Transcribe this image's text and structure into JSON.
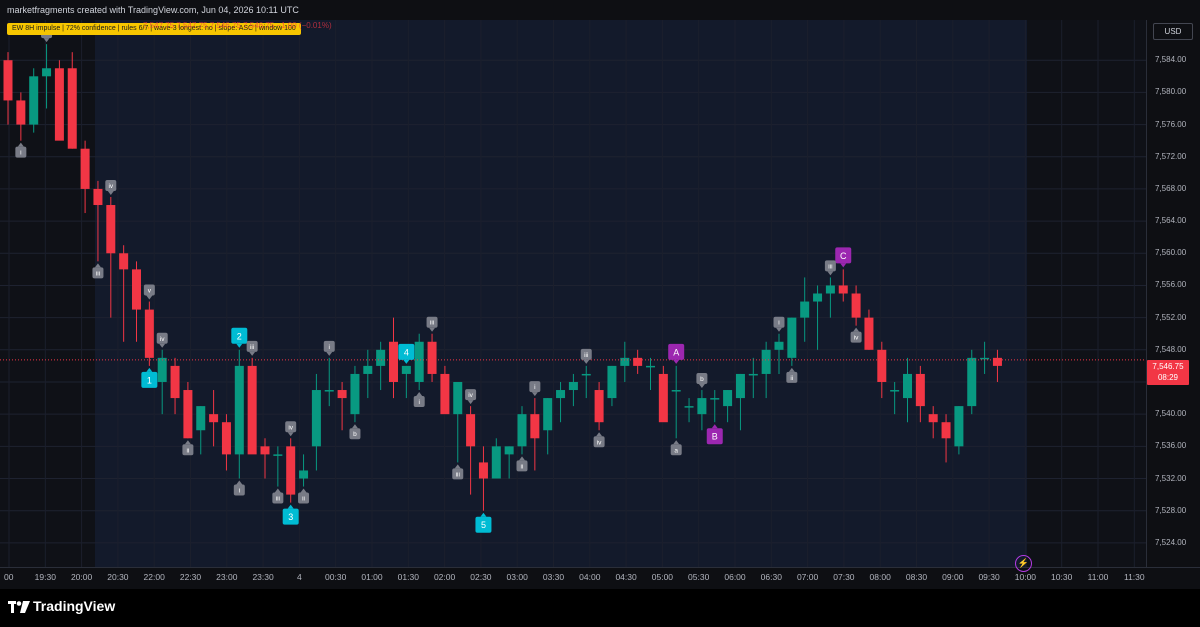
{
  "header": {
    "title": "marketfragments created with TradingView.com, Jun 04, 2026 10:11 UTC"
  },
  "indicator": {
    "label": "EW 8H impulse  |  72% confidence  |  rules 6/7  |  wave-3 longest: no  |  slope: ASC  |  window 100",
    "ohlc": "7,547.75  7,547.75  7,546.75  7,546.75  −1.00 (−0.01%)"
  },
  "axis": {
    "currency": "USD",
    "y_ticks": [
      "7,584.00",
      "7,580.00",
      "7,576.00",
      "7,572.00",
      "7,568.00",
      "7,564.00",
      "7,560.00",
      "7,556.00",
      "7,552.00",
      "7,548.00",
      "7,544.00",
      "7,540.00",
      "7,536.00",
      "7,532.00",
      "7,528.00",
      "7,524.00"
    ],
    "x_ticks": [
      "00",
      "19:30",
      "20:00",
      "20:30",
      "22:00",
      "22:30",
      "23:00",
      "23:30",
      "4",
      "00:30",
      "01:00",
      "01:30",
      "02:00",
      "02:30",
      "03:00",
      "03:30",
      "04:00",
      "04:30",
      "05:00",
      "05:30",
      "06:00",
      "06:30",
      "07:00",
      "07:30",
      "08:00",
      "08:30",
      "09:00",
      "09:30",
      "10:00",
      "10:30",
      "11:00",
      "11:30"
    ],
    "last_price": "7,546.75",
    "countdown": "08:29"
  },
  "chart_data": {
    "type": "candlestick",
    "y_range": [
      7521,
      7589
    ],
    "colors": {
      "up": "#089981",
      "down": "#f23645",
      "impulse": "#00bcd4",
      "corrective": "#9c27b0",
      "minor": "#787b86",
      "highlight": "#ffffff"
    },
    "candles": [
      [
        7584,
        7585,
        7576,
        7579
      ],
      [
        7579,
        7580,
        7574,
        7576
      ],
      [
        7576,
        7583,
        7575,
        7582
      ],
      [
        7582,
        7586,
        7578,
        7583
      ],
      [
        7583,
        7584,
        7575,
        7574
      ],
      [
        7583,
        7585,
        7573,
        7573
      ],
      [
        7573,
        7574,
        7565,
        7568
      ],
      [
        7568,
        7569,
        7559,
        7566
      ],
      [
        7566,
        7567,
        7552,
        7560
      ],
      [
        7560,
        7561,
        7549,
        7558
      ],
      [
        7558,
        7559,
        7549,
        7553
      ],
      [
        7553,
        7554,
        7546,
        7547
      ],
      [
        7544,
        7548,
        7540,
        7547
      ],
      [
        7546,
        7547,
        7540,
        7542
      ],
      [
        7543,
        7544,
        7537,
        7537
      ],
      [
        7538,
        7541,
        7535,
        7541
      ],
      [
        7540,
        7543,
        7536,
        7539
      ],
      [
        7539,
        7540,
        7533,
        7535
      ],
      [
        7535,
        7548,
        7532,
        7546
      ],
      [
        7546,
        7547,
        7539,
        7535
      ],
      [
        7536,
        7537,
        7532,
        7535
      ],
      [
        7535,
        7536,
        7531,
        7535
      ],
      [
        7536,
        7537,
        7529,
        7530
      ],
      [
        7532,
        7535,
        7531,
        7533
      ],
      [
        7536,
        7545,
        7533,
        7543
      ],
      [
        7543,
        7547,
        7541,
        7543
      ],
      [
        7543,
        7544,
        7538,
        7542
      ],
      [
        7540,
        7546,
        7539,
        7545
      ],
      [
        7545,
        7548,
        7542,
        7546
      ],
      [
        7546,
        7549,
        7543,
        7548
      ],
      [
        7549,
        7552,
        7542,
        7544
      ],
      [
        7545,
        7546,
        7542,
        7546
      ],
      [
        7544,
        7550,
        7543,
        7549
      ],
      [
        7549,
        7550,
        7544,
        7545
      ],
      [
        7545,
        7546,
        7541,
        7540
      ],
      [
        7540,
        7541,
        7534,
        7544
      ],
      [
        7540,
        7541,
        7530,
        7536
      ],
      [
        7534,
        7536,
        7528,
        7532
      ],
      [
        7532,
        7537,
        7532,
        7536
      ],
      [
        7535,
        7536,
        7532,
        7536
      ],
      [
        7536,
        7541,
        7535,
        7540
      ],
      [
        7540,
        7542,
        7533,
        7537
      ],
      [
        7538,
        7542,
        7535,
        7542
      ],
      [
        7542,
        7544,
        7539,
        7543
      ],
      [
        7543,
        7545,
        7541,
        7544
      ],
      [
        7545,
        7546,
        7542,
        7545
      ],
      [
        7543,
        7544,
        7538,
        7539
      ],
      [
        7542,
        7546,
        7541,
        7546
      ],
      [
        7546,
        7549,
        7544,
        7547
      ],
      [
        7547,
        7548,
        7545,
        7546
      ],
      [
        7546,
        7547,
        7543,
        7546
      ],
      [
        7545,
        7546,
        7540,
        7539
      ],
      [
        7543,
        7546,
        7537,
        7543
      ],
      [
        7541,
        7542,
        7539,
        7541
      ],
      [
        7540,
        7543,
        7538,
        7542
      ],
      [
        7542,
        7543,
        7539,
        7542
      ],
      [
        7541,
        7543,
        7539,
        7543
      ],
      [
        7542,
        7545,
        7538,
        7545
      ],
      [
        7545,
        7547,
        7542,
        7545
      ],
      [
        7545,
        7549,
        7542,
        7548
      ],
      [
        7548,
        7550,
        7545,
        7549
      ],
      [
        7547,
        7552,
        7546,
        7552
      ],
      [
        7552,
        7557,
        7549,
        7554
      ],
      [
        7554,
        7556,
        7548,
        7555
      ],
      [
        7555,
        7557,
        7552,
        7556
      ],
      [
        7556,
        7558,
        7554,
        7555
      ],
      [
        7555,
        7556,
        7551,
        7552
      ],
      [
        7552,
        7553,
        7548,
        7548
      ],
      [
        7548,
        7549,
        7542,
        7544
      ],
      [
        7543,
        7544,
        7540,
        7543
      ],
      [
        7542,
        7547,
        7539,
        7545
      ],
      [
        7545,
        7546,
        7539,
        7541
      ],
      [
        7540,
        7541,
        7537,
        7539
      ],
      [
        7539,
        7540,
        7534,
        7537
      ],
      [
        7536,
        7541,
        7535,
        7541
      ],
      [
        7541,
        7548,
        7540,
        7547
      ],
      [
        7547,
        7549,
        7545,
        7547
      ],
      [
        7547,
        7548,
        7544,
        7546
      ]
    ],
    "wave_labels": [
      {
        "text": "ii",
        "type": "minor",
        "i": 3,
        "side": "above"
      },
      {
        "text": "i",
        "type": "minor",
        "i": 1,
        "side": "below"
      },
      {
        "text": "iv",
        "type": "minor",
        "i": 8,
        "side": "above"
      },
      {
        "text": "iii",
        "type": "minor",
        "i": 7,
        "side": "below"
      },
      {
        "text": "1",
        "type": "impulse",
        "i": 11,
        "side": "below"
      },
      {
        "text": "2",
        "type": "impulse",
        "i": 18,
        "side": "above"
      },
      {
        "text": "3",
        "type": "impulse",
        "i": 22,
        "side": "below"
      },
      {
        "text": "4",
        "type": "impulse",
        "i": 31,
        "side": "above"
      },
      {
        "text": "5",
        "type": "impulse",
        "i": 37,
        "side": "below"
      },
      {
        "text": "A",
        "type": "corrective",
        "i": 52,
        "side": "above"
      },
      {
        "text": "B",
        "type": "corrective",
        "i": 55,
        "side": "below"
      },
      {
        "text": "C",
        "type": "corrective",
        "i": 65,
        "side": "above"
      },
      {
        "text": "iv",
        "type": "minor",
        "i": 12,
        "side": "above"
      },
      {
        "text": "v",
        "type": "minor",
        "i": 11,
        "side": "above"
      },
      {
        "text": "ii",
        "type": "minor",
        "i": 14,
        "side": "below"
      },
      {
        "text": "i",
        "type": "minor",
        "i": 18,
        "side": "below"
      },
      {
        "text": "iii",
        "type": "minor",
        "i": 19,
        "side": "above"
      },
      {
        "text": "iv",
        "type": "minor",
        "i": 22,
        "side": "above"
      },
      {
        "text": "iii",
        "type": "minor",
        "i": 21,
        "side": "below"
      },
      {
        "text": "ii",
        "type": "minor",
        "i": 23,
        "side": "below"
      },
      {
        "text": "iii",
        "type": "minor",
        "i": 33,
        "side": "above"
      },
      {
        "text": "i",
        "type": "minor",
        "i": 32,
        "side": "below"
      },
      {
        "text": "iv",
        "type": "minor",
        "i": 36,
        "side": "above"
      },
      {
        "text": "iii",
        "type": "minor",
        "i": 35,
        "side": "below"
      },
      {
        "text": "ii",
        "type": "minor",
        "i": 40,
        "side": "below"
      },
      {
        "text": "i",
        "type": "minor",
        "i": 41,
        "side": "above"
      },
      {
        "text": "iii",
        "type": "minor",
        "i": 45,
        "side": "above"
      },
      {
        "text": "iv",
        "type": "minor",
        "i": 46,
        "side": "below"
      },
      {
        "text": "b",
        "type": "minor",
        "i": 27,
        "side": "below"
      },
      {
        "text": "i",
        "type": "minor",
        "i": 25,
        "side": "above"
      },
      {
        "text": "a",
        "type": "minor",
        "i": 52,
        "side": "below"
      },
      {
        "text": "b",
        "type": "minor",
        "i": 54,
        "side": "above"
      },
      {
        "text": "i",
        "type": "minor",
        "i": 60,
        "side": "above"
      },
      {
        "text": "ii",
        "type": "minor",
        "i": 61,
        "side": "below"
      },
      {
        "text": "iii",
        "type": "minor",
        "i": 64,
        "side": "above"
      },
      {
        "text": "iv",
        "type": "minor",
        "i": 66,
        "side": "below"
      }
    ]
  }
}
